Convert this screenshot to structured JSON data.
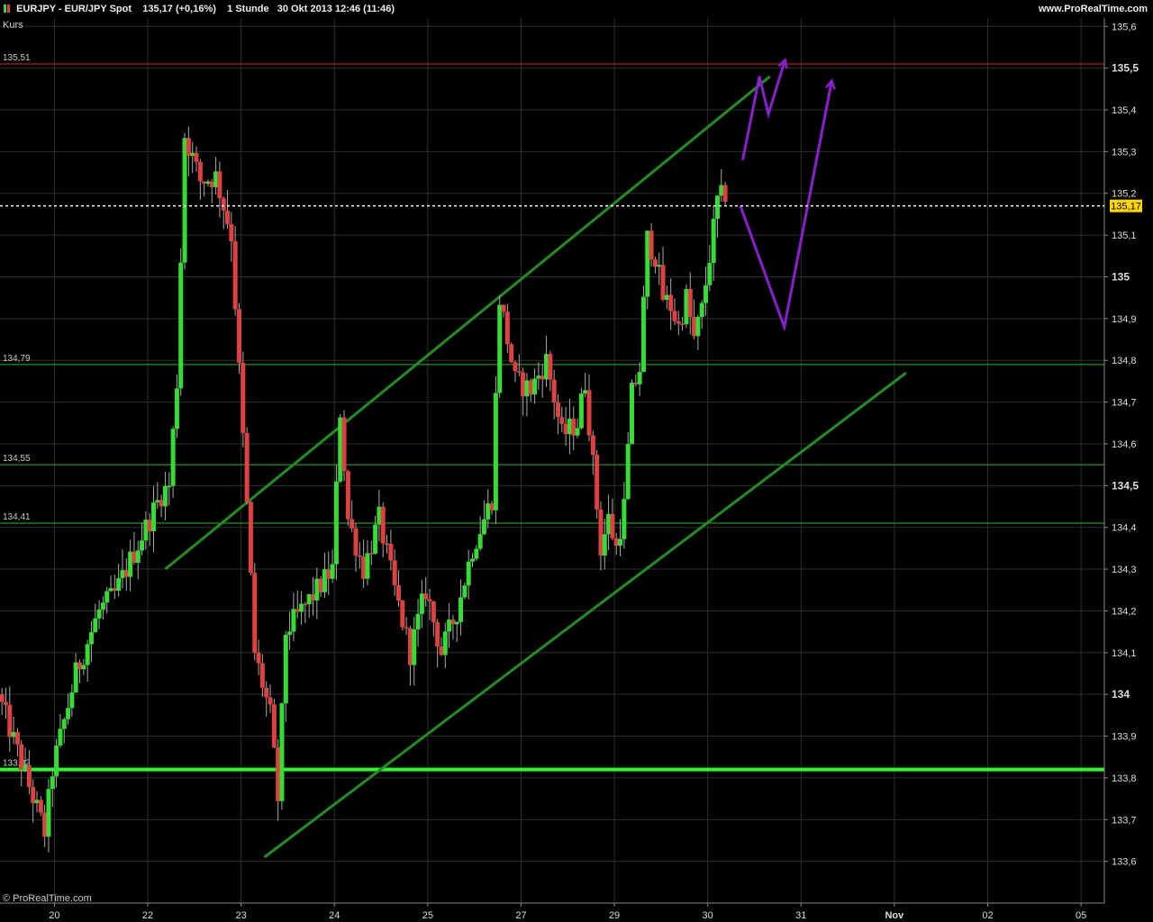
{
  "header": {
    "symbol": "EURJPY - EUR/JPY Spot",
    "quote": "135,17 (+0,16%)",
    "interval": "1 Stunde",
    "datetime": "30 Okt 2013 12:46 (11:46)",
    "site": "www.ProRealTime.com"
  },
  "plot_label": "Kurs",
  "copyright": "© ProRealTime.com",
  "colors": {
    "up": "#33dd33",
    "down": "#e04040",
    "trend": "#1f8f1f",
    "forecast": "#8a1fd0",
    "support": "#22ff22",
    "resistance": "#e02020",
    "level": "#22bb22",
    "price_tag": "#ffd700"
  },
  "chart_data": {
    "type": "candlestick",
    "y_axis": {
      "range": [
        133.5,
        135.62
      ],
      "ticks": [
        {
          "v": 135.6,
          "label": "135,6"
        },
        {
          "v": 135.5,
          "label": "135,5",
          "bold": true
        },
        {
          "v": 135.4,
          "label": "135,4"
        },
        {
          "v": 135.3,
          "label": "135,3"
        },
        {
          "v": 135.2,
          "label": "135,2"
        },
        {
          "v": 135.1,
          "label": "135,1"
        },
        {
          "v": 135.0,
          "label": "135",
          "bold": true
        },
        {
          "v": 134.9,
          "label": "134,9"
        },
        {
          "v": 134.8,
          "label": "134,8"
        },
        {
          "v": 134.7,
          "label": "134,7"
        },
        {
          "v": 134.6,
          "label": "134,6"
        },
        {
          "v": 134.5,
          "label": "134,5",
          "bold": true
        },
        {
          "v": 134.4,
          "label": "134,4"
        },
        {
          "v": 134.3,
          "label": "134,3"
        },
        {
          "v": 134.2,
          "label": "134,2"
        },
        {
          "v": 134.1,
          "label": "134,1"
        },
        {
          "v": 134.0,
          "label": "134",
          "bold": true
        },
        {
          "v": 133.9,
          "label": "133,9"
        },
        {
          "v": 133.8,
          "label": "133,8"
        },
        {
          "v": 133.7,
          "label": "133,7"
        },
        {
          "v": 133.6,
          "label": "133,6"
        }
      ]
    },
    "x_axis": {
      "labels": [
        {
          "t": 6,
          "label": "20"
        },
        {
          "t": 30,
          "label": "22"
        },
        {
          "t": 54,
          "label": "23"
        },
        {
          "t": 78,
          "label": "24"
        },
        {
          "t": 102,
          "label": "25"
        },
        {
          "t": 126,
          "label": "27"
        },
        {
          "t": 150,
          "label": "29"
        },
        {
          "t": 174,
          "label": "30"
        },
        {
          "t": 198,
          "label": "31"
        },
        {
          "t": 222,
          "label": "Nov",
          "bold": true
        },
        {
          "t": 246,
          "label": "02"
        },
        {
          "t": 270,
          "label": "05"
        }
      ],
      "t_range": [
        -8,
        276
      ]
    },
    "grid": true,
    "last_price": {
      "value": 135.17,
      "label": "135,17"
    },
    "levels": [
      {
        "value": 135.51,
        "label": "135,51",
        "kind": "resistance"
      },
      {
        "value": 134.79,
        "label": "134,79",
        "kind": "level"
      },
      {
        "value": 134.55,
        "label": "134,55",
        "kind": "level"
      },
      {
        "value": 134.41,
        "label": "134,41",
        "kind": "level"
      },
      {
        "value": 133.82,
        "label": "133,82",
        "kind": "support"
      }
    ],
    "trendlines": [
      {
        "from": [
          34.5,
          134.3
        ],
        "to": [
          190,
          135.48
        ],
        "kind": "trend"
      },
      {
        "from": [
          60,
          133.61
        ],
        "to": [
          225,
          134.77
        ],
        "kind": "trend"
      }
    ],
    "forecast_paths": [
      {
        "points": [
          [
            182.4,
            135.17
          ],
          [
            193.7,
            134.88
          ],
          [
            205.9,
            135.47
          ]
        ],
        "arrow": true
      },
      {
        "points": [
          [
            183,
            135.28
          ],
          [
            187.3,
            135.48
          ],
          [
            189.6,
            135.39
          ],
          [
            193.9,
            135.52
          ]
        ],
        "arrow": true
      }
    ],
    "segments": [
      [
        -8,
        134.0
      ],
      [
        4,
        133.67
      ],
      [
        6,
        133.82
      ],
      [
        12,
        134.05
      ],
      [
        18,
        134.2
      ],
      [
        22,
        134.24
      ],
      [
        26,
        134.32
      ],
      [
        30,
        134.4
      ],
      [
        34,
        134.48
      ],
      [
        36,
        134.5
      ],
      [
        38,
        134.75
      ],
      [
        40,
        135.34
      ],
      [
        44,
        135.23
      ],
      [
        48,
        135.24
      ],
      [
        52,
        135.1
      ],
      [
        56,
        134.45
      ],
      [
        58,
        134.1
      ],
      [
        62,
        133.95
      ],
      [
        64,
        133.75
      ],
      [
        66,
        134.15
      ],
      [
        70,
        134.2
      ],
      [
        74,
        134.25
      ],
      [
        78,
        134.3
      ],
      [
        80,
        134.68
      ],
      [
        82,
        134.42
      ],
      [
        86,
        134.3
      ],
      [
        90,
        134.42
      ],
      [
        94,
        134.25
      ],
      [
        98,
        134.1
      ],
      [
        102,
        134.25
      ],
      [
        106,
        134.1
      ],
      [
        110,
        134.2
      ],
      [
        114,
        134.35
      ],
      [
        117,
        134.42
      ],
      [
        119,
        134.47
      ],
      [
        121,
        134.95
      ],
      [
        125,
        134.75
      ],
      [
        129,
        134.73
      ],
      [
        133,
        134.8
      ],
      [
        137,
        134.62
      ],
      [
        141,
        134.65
      ],
      [
        143,
        134.75
      ],
      [
        145,
        134.55
      ],
      [
        147,
        134.35
      ],
      [
        149,
        134.42
      ],
      [
        151,
        134.35
      ],
      [
        153,
        134.45
      ],
      [
        155,
        134.72
      ],
      [
        157,
        134.78
      ],
      [
        159,
        135.09
      ],
      [
        161,
        135.05
      ],
      [
        163,
        134.95
      ],
      [
        165,
        134.93
      ],
      [
        167,
        134.88
      ],
      [
        169,
        134.95
      ],
      [
        171,
        134.85
      ],
      [
        173,
        134.92
      ],
      [
        175,
        135.05
      ],
      [
        177,
        135.18
      ],
      [
        179,
        135.2
      ]
    ]
  }
}
